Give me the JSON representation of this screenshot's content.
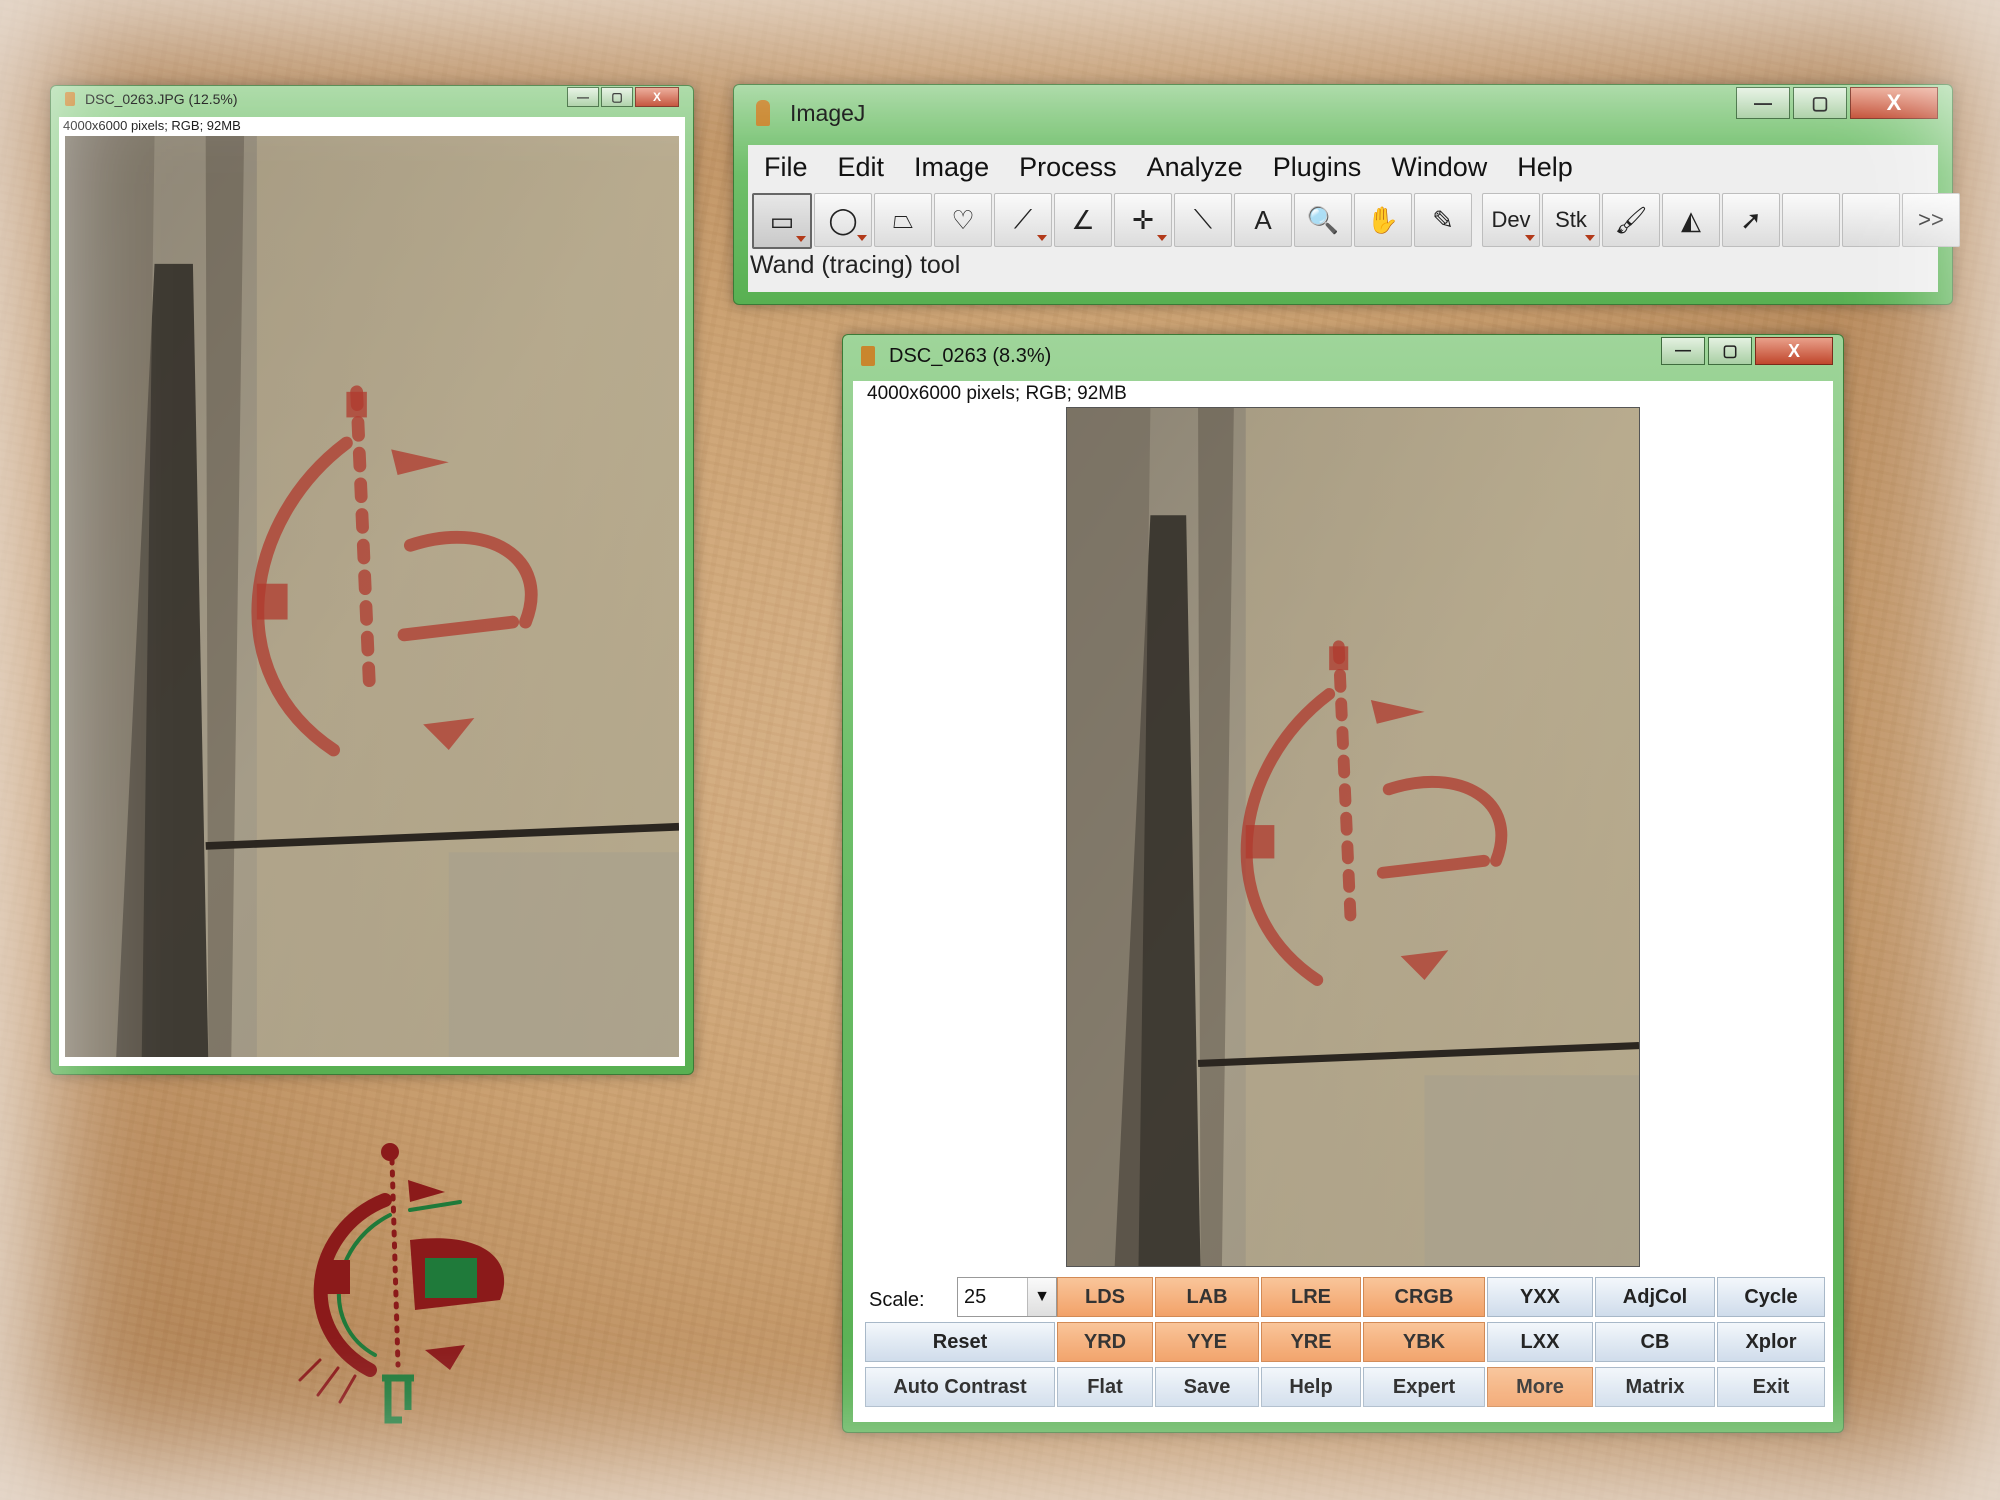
{
  "small_window": {
    "title": "DSC_0263.JPG (12.5%)",
    "info": "4000x6000 pixels; RGB; 92MB"
  },
  "imagej": {
    "title": "ImageJ",
    "menu": [
      "File",
      "Edit",
      "Image",
      "Process",
      "Analyze",
      "Plugins",
      "Window",
      "Help"
    ],
    "tools": [
      {
        "name": "rectangle-tool",
        "glyph": "▭",
        "active": true
      },
      {
        "name": "oval-tool",
        "glyph": "◯"
      },
      {
        "name": "polygon-tool",
        "glyph": "⏢"
      },
      {
        "name": "freehand-tool",
        "glyph": "♡"
      },
      {
        "name": "line-tool",
        "glyph": "⟋"
      },
      {
        "name": "angle-tool",
        "glyph": "∠"
      },
      {
        "name": "point-tool",
        "glyph": "✛"
      },
      {
        "name": "wand-tool",
        "glyph": "⟍"
      },
      {
        "name": "text-tool",
        "glyph": "A"
      },
      {
        "name": "magnifier-tool",
        "glyph": "🔍"
      },
      {
        "name": "hand-tool",
        "glyph": "✋"
      },
      {
        "name": "color-picker-tool",
        "glyph": "✎"
      },
      {
        "name": "dev-menu",
        "glyph": "Dev"
      },
      {
        "name": "stk-menu",
        "glyph": "Stk"
      },
      {
        "name": "brush-tool",
        "glyph": "🖌"
      },
      {
        "name": "flood-fill-tool",
        "glyph": "◭"
      },
      {
        "name": "arrow-tool",
        "glyph": "➚"
      },
      {
        "name": "empty-slot-1",
        "glyph": ""
      },
      {
        "name": "empty-slot-2",
        "glyph": ""
      },
      {
        "name": "more-tools",
        "glyph": ">>"
      }
    ],
    "status": "Wand (tracing) tool"
  },
  "image_window": {
    "title": "DSC_0263 (8.3%)",
    "info": "4000x6000 pixels; RGB; 92MB",
    "scale_label": "Scale:",
    "scale_value": "25",
    "buttons": {
      "reset": "Reset",
      "auto_contrast": "Auto Contrast",
      "lds": "LDS",
      "lab": "LAB",
      "lre": "LRE",
      "crgb": "CRGB",
      "yxx": "YXX",
      "adjcol": "AdjCol",
      "cycle": "Cycle",
      "yrd": "YRD",
      "yye": "YYE",
      "yre": "YRE",
      "ybk": "YBK",
      "lxx": "LXX",
      "cb": "CB",
      "xplor": "Xplor",
      "flat": "Flat",
      "save": "Save",
      "help": "Help",
      "expert": "Expert",
      "more": "More",
      "matrix": "Matrix",
      "exit": "Exit"
    }
  },
  "colors": {
    "window_frame": "#6fbf6a",
    "button_orange": "#f2a269",
    "button_blue": "#cfdceb",
    "pigment_red": "#b03a2e",
    "logo_red": "#8b1a1a",
    "logo_green": "#1f7a3a"
  },
  "window_controls": {
    "minimize": "—",
    "maximize": "▢",
    "close": "X"
  }
}
